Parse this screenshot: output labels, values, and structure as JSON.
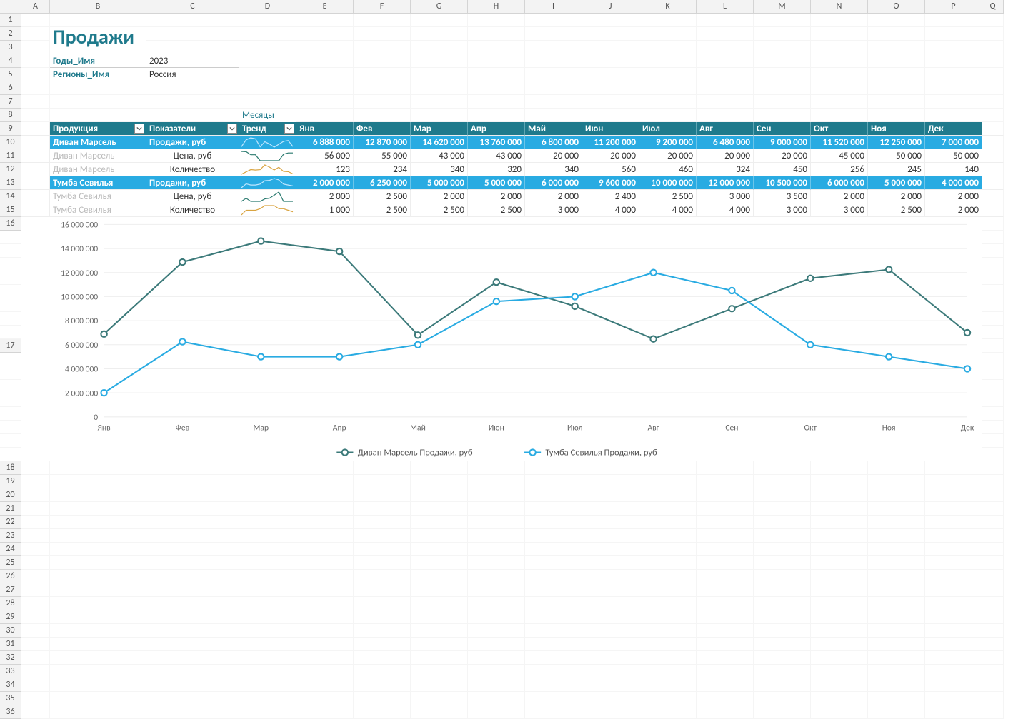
{
  "title": "Продажи",
  "filters": {
    "year_label": "Годы_Имя",
    "year_value": "2023",
    "region_label": "Регионы_Имя",
    "region_value": "Россия"
  },
  "columns_top": [
    "A",
    "B",
    "C",
    "D",
    "E",
    "F",
    "G",
    "H",
    "I",
    "J",
    "K",
    "L",
    "M",
    "N",
    "O",
    "P",
    "Q"
  ],
  "months_label": "Месяцы",
  "table_headers": {
    "product": "Продукция",
    "metric": "Показатели",
    "trend": "Тренд",
    "months": [
      "Янв",
      "Фев",
      "Мар",
      "Апр",
      "Май",
      "Июн",
      "Июл",
      "Авг",
      "Сен",
      "Окт",
      "Ноя",
      "Дек"
    ]
  },
  "rows": [
    {
      "product": "Диван Марсель",
      "metric": "Продажи, руб",
      "type": "sales",
      "values": [
        "6 888 000",
        "12 870 000",
        "14 620 000",
        "13 760 000",
        "6 800 000",
        "11 200 000",
        "9 200 000",
        "6 480 000",
        "9 000 000",
        "11 520 000",
        "12 250 000",
        "7 000 000"
      ]
    },
    {
      "product": "Диван Марсель",
      "metric": "Цена, руб",
      "type": "price",
      "values": [
        "56 000",
        "55 000",
        "43 000",
        "43 000",
        "20 000",
        "20 000",
        "20 000",
        "20 000",
        "20 000",
        "45 000",
        "50 000",
        "50 000"
      ]
    },
    {
      "product": "Диван Марсель",
      "metric": "Количество",
      "type": "qty",
      "values": [
        "123",
        "234",
        "340",
        "320",
        "340",
        "560",
        "460",
        "324",
        "450",
        "256",
        "245",
        "140"
      ]
    },
    {
      "product": "Тумба Севилья",
      "metric": "Продажи, руб",
      "type": "sales",
      "values": [
        "2 000 000",
        "6 250 000",
        "5 000 000",
        "5 000 000",
        "6 000 000",
        "9 600 000",
        "10 000 000",
        "12 000 000",
        "10 500 000",
        "6 000 000",
        "5 000 000",
        "4 000 000"
      ]
    },
    {
      "product": "Тумба Севилья",
      "metric": "Цена, руб",
      "type": "price",
      "values": [
        "2 000",
        "2 500",
        "2 000",
        "2 000",
        "2 000",
        "2 400",
        "2 500",
        "3 000",
        "3 500",
        "2 000",
        "2 000",
        "2 000"
      ]
    },
    {
      "product": "Тумба Севилья",
      "metric": "Количество",
      "type": "qty",
      "values": [
        "1 000",
        "2 500",
        "2 500",
        "2 500",
        "3 000",
        "4 000",
        "4 000",
        "4 000",
        "3 000",
        "3 000",
        "2 500",
        "2 000"
      ]
    }
  ],
  "chart_data": {
    "type": "line",
    "categories": [
      "Янв",
      "Фев",
      "Мар",
      "Апр",
      "Май",
      "Июн",
      "Июл",
      "Авг",
      "Сен",
      "Окт",
      "Ноя",
      "Дек"
    ],
    "series": [
      {
        "name": "Диван Марсель Продажи, руб",
        "values": [
          6888000,
          12870000,
          14620000,
          13760000,
          6800000,
          11200000,
          9200000,
          6480000,
          9000000,
          11520000,
          12250000,
          7000000
        ],
        "color": "#3c7a7a"
      },
      {
        "name": "Тумба Севилья Продажи, руб",
        "values": [
          2000000,
          6250000,
          5000000,
          5000000,
          6000000,
          9600000,
          10000000,
          12000000,
          10500000,
          6000000,
          5000000,
          4000000
        ],
        "color": "#29abe2"
      }
    ],
    "ylim": [
      0,
      16000000
    ],
    "yticks": [
      "0",
      "2 000 000",
      "4 000 000",
      "6 000 000",
      "8 000 000",
      "10 000 000",
      "12 000 000",
      "14 000 000",
      "16 000 000"
    ]
  }
}
